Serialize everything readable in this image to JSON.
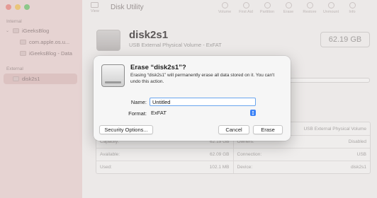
{
  "app": {
    "title": "Disk Utility",
    "view_label": "View"
  },
  "toolbar": {
    "actions": [
      "Volume",
      "First Aid",
      "Partition",
      "Erase",
      "Restore",
      "Unmount",
      "Info"
    ]
  },
  "sidebar": {
    "internal_label": "Internal",
    "external_label": "External",
    "items": [
      {
        "label": "iGeeksBlog",
        "indent": 1,
        "chevron": "⌄"
      },
      {
        "label": "com.apple.os.u...",
        "indent": 2,
        "chevron": ""
      },
      {
        "label": "iGeeksBlog - Data",
        "indent": 2,
        "chevron": ""
      },
      {
        "label": "disk2s1",
        "indent": 1,
        "chevron": ""
      }
    ]
  },
  "disk": {
    "name": "disk2s1",
    "subtitle": "USB External Physical Volume - ExFAT",
    "size": "62.19 GB",
    "used_fraction": 0.002
  },
  "info": {
    "type_value": "USB External Physical Volume",
    "rows": [
      {
        "label1": "Capacity:",
        "value1": "62.19 GB",
        "label2": "Owners:",
        "value2": "Disabled"
      },
      {
        "label1": "Available:",
        "value1": "62.09 GB",
        "label2": "Connection:",
        "value2": "USB"
      },
      {
        "label1": "Used:",
        "value1": "102.1 MB",
        "label2": "Device:",
        "value2": "disk2s1"
      }
    ]
  },
  "dialog": {
    "title": "Erase “disk2s1”?",
    "message": "Erasing “disk2s1” will permanently erase all data stored on it. You can't undo this action.",
    "name_label": "Name:",
    "name_value": "Untitled",
    "format_label": "Format:",
    "format_value": "ExFAT",
    "security_options_label": "Security Options...",
    "cancel_label": "Cancel",
    "erase_label": "Erase"
  },
  "colors": {
    "input_focus": "#6aa5ee",
    "select_accent": "#3b82f6",
    "sidebar_bg": "#e6d3d2"
  }
}
